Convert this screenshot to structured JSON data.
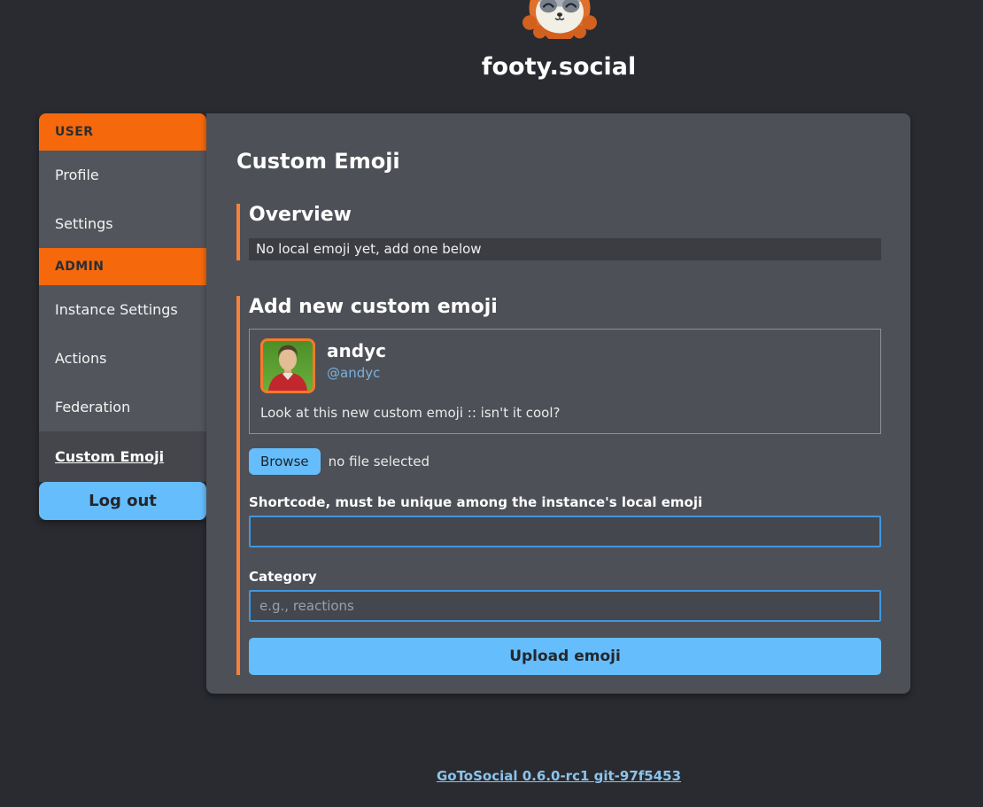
{
  "header": {
    "instance_title": "footy.social",
    "logo_icon": "sloth-mascot-icon"
  },
  "sidebar": {
    "sections": [
      {
        "header": "USER",
        "items": [
          {
            "label": "Profile"
          },
          {
            "label": "Settings"
          }
        ]
      },
      {
        "header": "ADMIN",
        "items": [
          {
            "label": "Instance Settings"
          },
          {
            "label": "Actions"
          },
          {
            "label": "Federation"
          }
        ]
      }
    ],
    "active_item": "Custom Emoji",
    "logout_label": "Log out"
  },
  "main": {
    "title": "Custom Emoji",
    "overview": {
      "heading": "Overview",
      "empty_message": "No local emoji yet, add one below"
    },
    "add_form": {
      "heading": "Add new custom emoji",
      "preview": {
        "display_name": "andyc",
        "username": "@andyc",
        "status_text": "Look at this new custom emoji :: isn't it cool?"
      },
      "file_input": {
        "browse_label": "Browse",
        "no_file_text": "no file selected"
      },
      "shortcode": {
        "label": "Shortcode, must be unique among the instance's local emoji",
        "value": "",
        "placeholder": ""
      },
      "category": {
        "label": "Category",
        "value": "",
        "placeholder": "e.g., reactions"
      },
      "submit_label": "Upload emoji"
    }
  },
  "footer": {
    "version_link": "GoToSocial 0.6.0-rc1 git-97f5453"
  },
  "colors": {
    "page-bg": "#292b30",
    "panel-bg": "#4e5057",
    "sidebar-bg": "#53555c",
    "active-bg": "#44464c",
    "statusbar-bg": "#3b3d43",
    "input-bg": "#45474e",
    "orange": "#f5690c",
    "orange-light": "#f5813c",
    "blue-btn": "#66bdfb",
    "blue-border": "#3f97de",
    "link-blue": "#8bc3ec",
    "text-light": "#fbfbfb"
  }
}
